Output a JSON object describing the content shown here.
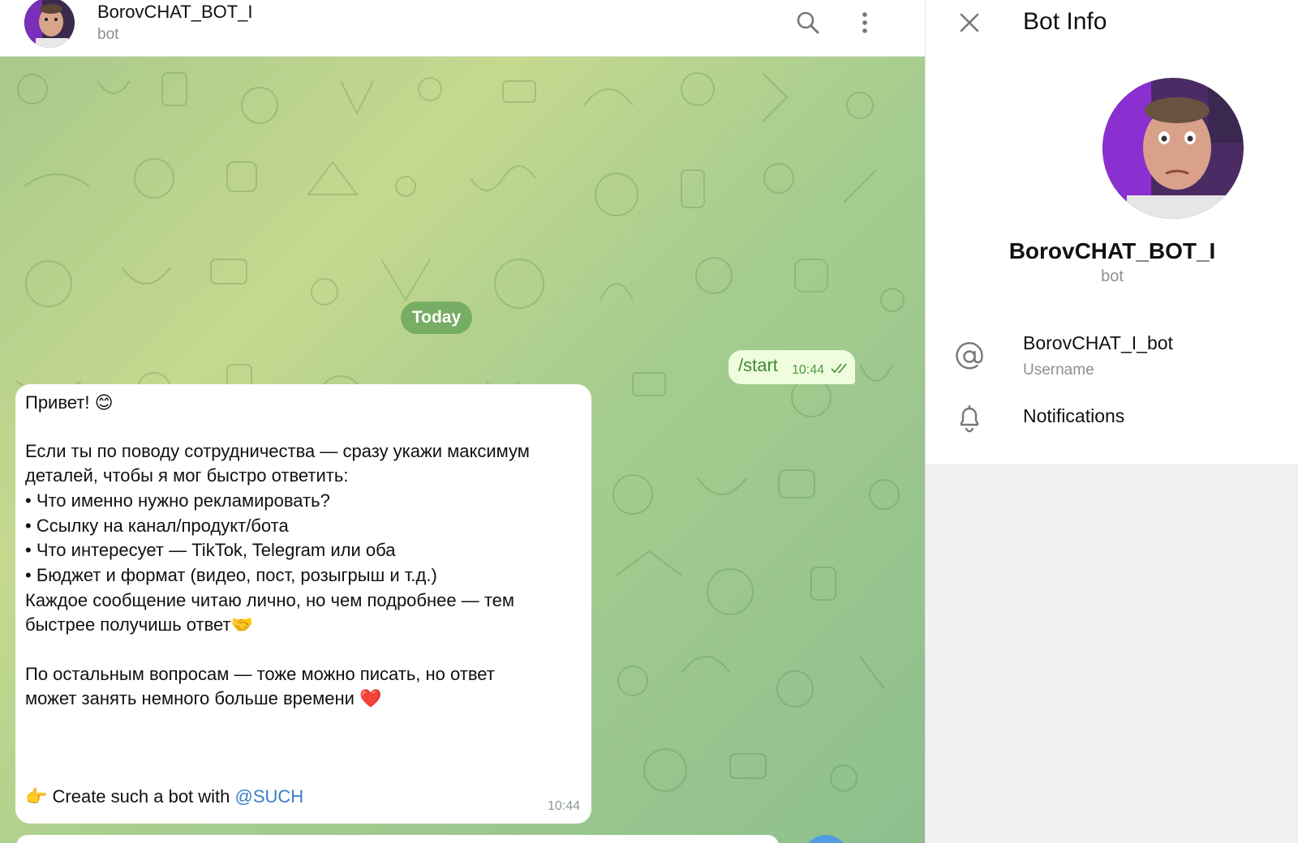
{
  "chat": {
    "title": "BorovCHAT_BOT_I",
    "subtitle": "bot",
    "date_label": "Today",
    "outgoing": {
      "text": "/start",
      "time": "10:44"
    },
    "incoming": {
      "lines": [
        "Привет! 😊",
        "",
        "Если ты по поводу сотрудничества — сразу укажи максимум",
        "деталей, чтобы я мог быстро ответить:",
        "• Что именно нужно рекламировать?",
        "• Ссылку на канал/продукт/бота",
        "• Что интересует — TikTok, Telegram или оба",
        "• Бюджет и формат (видео, пост, розыгрыш и т.д.)",
        "Каждое сообщение читаю лично, но чем подробнее — тем",
        "быстрее получишь ответ🤝",
        "",
        "По остальным вопросам — тоже можно писать, но ответ",
        "может занять немного больше времени ❤️"
      ],
      "footer_prefix": "👉 Create such a bot with ",
      "footer_link": "@SUCH",
      "time": "10:44"
    }
  },
  "icons": {
    "header": [
      "search-icon",
      "more-vertical-icon"
    ],
    "panel": [
      "close-icon",
      "at-sign-icon",
      "bell-icon"
    ]
  },
  "info": {
    "title": "Bot Info",
    "name": "BorovCHAT_BOT_I",
    "subtitle": "bot",
    "username_value": "BorovCHAT_I_bot",
    "username_label": "Username",
    "notifications_label": "Notifications"
  },
  "colors": {
    "outgoing_bubble": "#effdde",
    "date_pill": "#62a056",
    "link": "#3a7ec6"
  }
}
